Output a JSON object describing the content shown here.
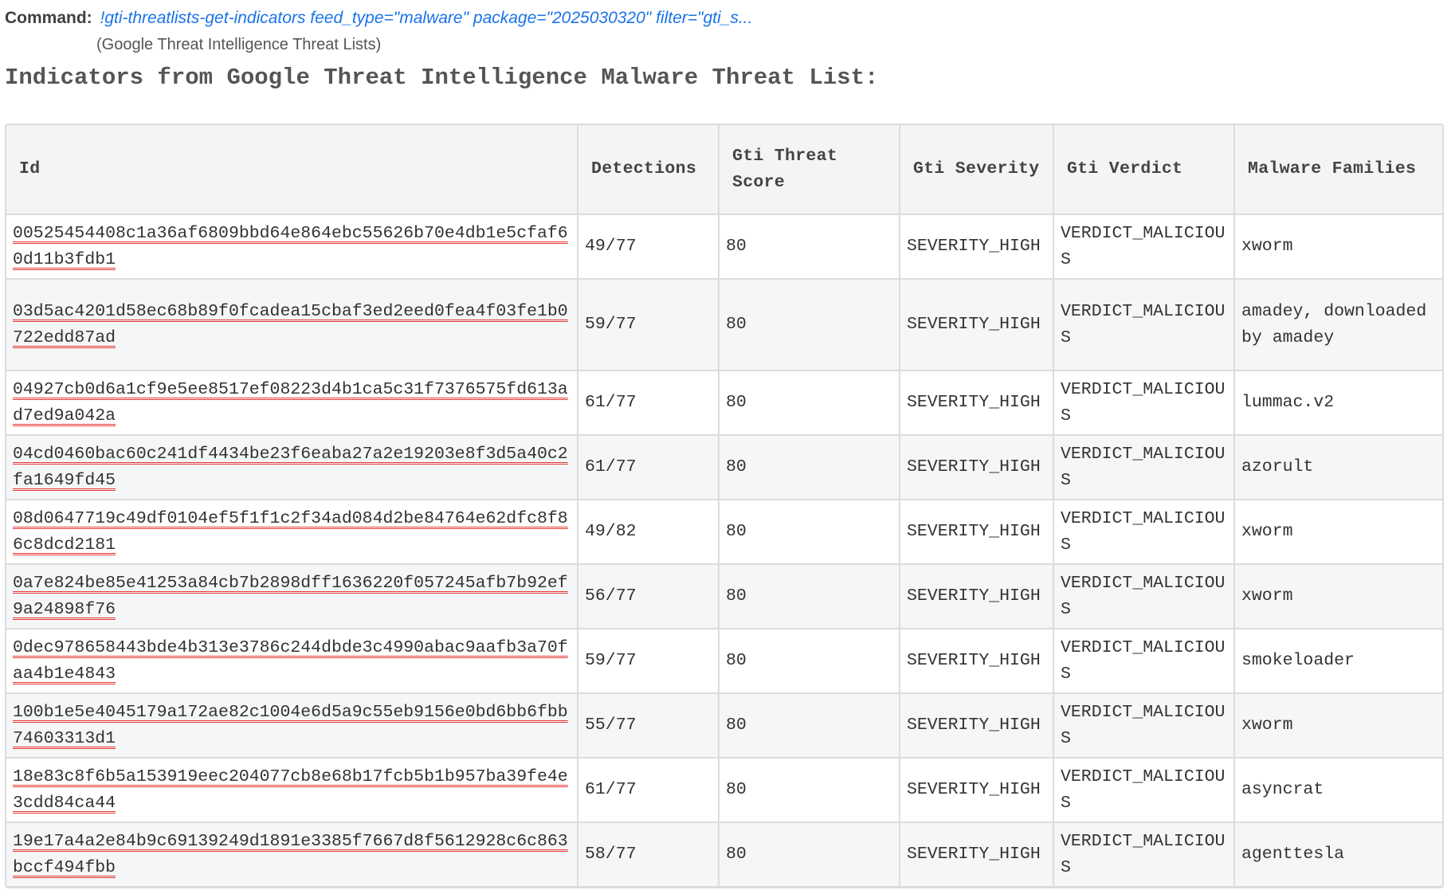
{
  "command": {
    "label": "Command:",
    "text": "!gti-threatlists-get-indicators feed_type=\"malware\" package=\"2025030320\" filter=\"gti_s...",
    "source": "(Google Threat Intelligence Threat Lists)"
  },
  "title": "Indicators from Google Threat Intelligence Malware Threat List:",
  "table": {
    "columns": [
      "Id",
      "Detections",
      "Gti Threat Score",
      "Gti Severity",
      "Gti Verdict",
      "Malware Families"
    ],
    "rows": [
      {
        "id": "00525454408c1a36af6809bbd64e864ebc55626b70e4db1e5cfaf60d11b3fdb1",
        "detections": "49/77",
        "score": "80",
        "severity": "SEVERITY_HIGH",
        "verdict": "VERDICT_MALICIOUS",
        "families": "xworm"
      },
      {
        "id": "03d5ac4201d58ec68b89f0fcadea15cbaf3ed2eed0fea4f03fe1b0722edd87ad",
        "detections": "59/77",
        "score": "80",
        "severity": "SEVERITY_HIGH",
        "verdict": "VERDICT_MALICIOUS",
        "families": "amadey, downloaded by amadey"
      },
      {
        "id": "04927cb0d6a1cf9e5ee8517ef08223d4b1ca5c31f7376575fd613ad7ed9a042a",
        "detections": "61/77",
        "score": "80",
        "severity": "SEVERITY_HIGH",
        "verdict": "VERDICT_MALICIOUS",
        "families": "lummac.v2"
      },
      {
        "id": "04cd0460bac60c241df4434be23f6eaba27a2e19203e8f3d5a40c2fa1649fd45",
        "detections": "61/77",
        "score": "80",
        "severity": "SEVERITY_HIGH",
        "verdict": "VERDICT_MALICIOUS",
        "families": "azorult"
      },
      {
        "id": "08d0647719c49df0104ef5f1f1c2f34ad084d2be84764e62dfc8f86c8dcd2181",
        "detections": "49/82",
        "score": "80",
        "severity": "SEVERITY_HIGH",
        "verdict": "VERDICT_MALICIOUS",
        "families": "xworm"
      },
      {
        "id": "0a7e824be85e41253a84cb7b2898dff1636220f057245afb7b92ef9a24898f76",
        "detections": "56/77",
        "score": "80",
        "severity": "SEVERITY_HIGH",
        "verdict": "VERDICT_MALICIOUS",
        "families": "xworm"
      },
      {
        "id": "0dec978658443bde4b313e3786c244dbde3c4990abac9aafb3a70faa4b1e4843",
        "detections": "59/77",
        "score": "80",
        "severity": "SEVERITY_HIGH",
        "verdict": "VERDICT_MALICIOUS",
        "families": "smokeloader"
      },
      {
        "id": "100b1e5e4045179a172ae82c1004e6d5a9c55eb9156e0bd6bb6fbb74603313d1",
        "detections": "55/77",
        "score": "80",
        "severity": "SEVERITY_HIGH",
        "verdict": "VERDICT_MALICIOUS",
        "families": "xworm"
      },
      {
        "id": "18e83c8f6b5a153919eec204077cb8e68b17fcb5b1b957ba39fe4e3cdd84ca44",
        "detections": "61/77",
        "score": "80",
        "severity": "SEVERITY_HIGH",
        "verdict": "VERDICT_MALICIOUS",
        "families": "asyncrat"
      },
      {
        "id": "19e17a4a2e84b9c69139249d1891e3385f7667d8f5612928c6c863bccf494fbb",
        "detections": "58/77",
        "score": "80",
        "severity": "SEVERITY_HIGH",
        "verdict": "VERDICT_MALICIOUS",
        "families": "agenttesla"
      }
    ]
  },
  "colors": {
    "command_link": "#1a73e8",
    "header_bg": "#f4f4f4",
    "row_alt_bg": "#f5f6f7",
    "border": "#dcdcdc",
    "id_underline": "#e53935"
  }
}
